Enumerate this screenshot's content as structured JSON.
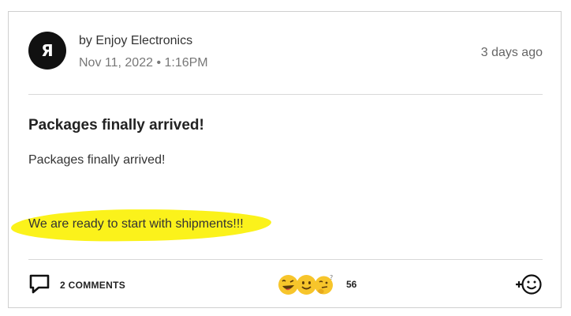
{
  "post": {
    "avatar_letter": "Я",
    "author": "by Enjoy Electronics",
    "date": "Nov 11, 2022 • 1:16PM",
    "time_ago": "3 days ago",
    "title": "Packages finally arrived!",
    "body_line_1": "Packages finally arrived!",
    "body_line_2": "We are ready to start with shipments!!!"
  },
  "footer": {
    "comments_label": "2 COMMENTS",
    "reactions": [
      "laughing-wink-emoji",
      "smile-emoji",
      "thinking-emoji"
    ],
    "reaction_count": "56"
  },
  "colors": {
    "highlight": "#fbf21b",
    "emoji_yellow": "#f7c52b",
    "avatar_bg": "#111111"
  }
}
